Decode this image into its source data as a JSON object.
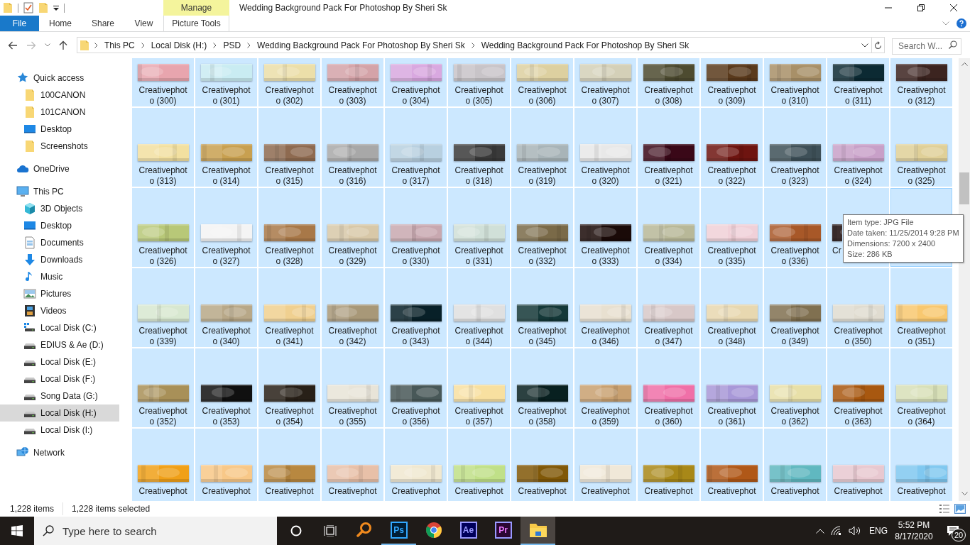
{
  "title_bar": {
    "title": "Wedding Background Pack For Photoshop By Sheri Sk",
    "contextual_group": "Manage"
  },
  "ribbon": {
    "tabs": [
      {
        "label": "File",
        "kind": "file",
        "selected": false
      },
      {
        "label": "Home",
        "kind": "tab",
        "selected": false
      },
      {
        "label": "Share",
        "kind": "tab",
        "selected": false
      },
      {
        "label": "View",
        "kind": "tab",
        "selected": false
      },
      {
        "label": "Picture Tools",
        "kind": "contextual",
        "selected": false
      }
    ]
  },
  "address_bar": {
    "breadcrumbs": [
      "This PC",
      "Local Disk (H:)",
      "PSD",
      "Wedding Background Pack For Photoshop By Sheri Sk",
      "Wedding Background Pack For Photoshop By Sheri Sk"
    ],
    "search_placeholder": "Search W..."
  },
  "navigation": [
    {
      "label": "Quick access",
      "kind": "star",
      "selected": false,
      "children": [
        {
          "label": "100CANON",
          "kind": "folder",
          "selected": false
        },
        {
          "label": "101CANON",
          "kind": "folder",
          "selected": false
        },
        {
          "label": "Desktop",
          "kind": "desktop",
          "selected": false
        },
        {
          "label": "Screenshots",
          "kind": "folder",
          "selected": false
        }
      ]
    },
    {
      "label": "OneDrive",
      "kind": "cloud",
      "selected": false
    },
    {
      "label": "This PC",
      "kind": "computer",
      "selected": false,
      "children": [
        {
          "label": "3D Objects",
          "kind": "cube",
          "selected": false
        },
        {
          "label": "Desktop",
          "kind": "desktop",
          "selected": false
        },
        {
          "label": "Documents",
          "kind": "document",
          "selected": false
        },
        {
          "label": "Downloads",
          "kind": "download",
          "selected": false
        },
        {
          "label": "Music",
          "kind": "music",
          "selected": false
        },
        {
          "label": "Pictures",
          "kind": "pictures",
          "selected": false
        },
        {
          "label": "Videos",
          "kind": "videos",
          "selected": false
        },
        {
          "label": "Local Disk (C:)",
          "kind": "system-disk",
          "selected": false
        },
        {
          "label": "EDIUS & Ae (D:)",
          "kind": "disk",
          "selected": false
        },
        {
          "label": "Local Disk (E:)",
          "kind": "disk",
          "selected": false
        },
        {
          "label": "Local Disk (F:)",
          "kind": "disk",
          "selected": false
        },
        {
          "label": "Song Data (G:)",
          "kind": "disk",
          "selected": false
        },
        {
          "label": "Local Disk (H:)",
          "kind": "disk",
          "selected": true
        },
        {
          "label": "Local Disk (I:)",
          "kind": "disk",
          "selected": false
        }
      ]
    },
    {
      "label": "Network",
      "kind": "network",
      "selected": false
    }
  ],
  "files": [
    {
      "label": "Creativephoto (300)",
      "kind": "file",
      "selected": true,
      "hovered": false
    },
    {
      "label": "Creativephoto (301)",
      "kind": "file",
      "selected": true,
      "hovered": false
    },
    {
      "label": "Creativephoto (302)",
      "kind": "file",
      "selected": true,
      "hovered": false
    },
    {
      "label": "Creativephoto (303)",
      "kind": "file",
      "selected": true,
      "hovered": false
    },
    {
      "label": "Creativephoto (304)",
      "kind": "file",
      "selected": true,
      "hovered": false
    },
    {
      "label": "Creativephoto (305)",
      "kind": "file",
      "selected": true,
      "hovered": false
    },
    {
      "label": "Creativephoto (306)",
      "kind": "file",
      "selected": true,
      "hovered": false
    },
    {
      "label": "Creativephoto (307)",
      "kind": "file",
      "selected": true,
      "hovered": false
    },
    {
      "label": "Creativephoto (308)",
      "kind": "file",
      "selected": true,
      "hovered": false
    },
    {
      "label": "Creativephoto (309)",
      "kind": "file",
      "selected": true,
      "hovered": false
    },
    {
      "label": "Creativephoto (310)",
      "kind": "file",
      "selected": true,
      "hovered": false
    },
    {
      "label": "Creativephoto (311)",
      "kind": "file",
      "selected": true,
      "hovered": false
    },
    {
      "label": "Creativephoto (312)",
      "kind": "file",
      "selected": true,
      "hovered": false
    },
    {
      "label": "Creativephoto (313)",
      "kind": "file",
      "selected": true,
      "hovered": false
    },
    {
      "label": "Creativephoto (314)",
      "kind": "file",
      "selected": true,
      "hovered": false
    },
    {
      "label": "Creativephoto (315)",
      "kind": "file",
      "selected": true,
      "hovered": false
    },
    {
      "label": "Creativephoto (316)",
      "kind": "file",
      "selected": true,
      "hovered": false
    },
    {
      "label": "Creativephoto (317)",
      "kind": "file",
      "selected": true,
      "hovered": false
    },
    {
      "label": "Creativephoto (318)",
      "kind": "file",
      "selected": true,
      "hovered": false
    },
    {
      "label": "Creativephoto (319)",
      "kind": "file",
      "selected": true,
      "hovered": false
    },
    {
      "label": "Creativephoto (320)",
      "kind": "file",
      "selected": true,
      "hovered": false
    },
    {
      "label": "Creativephoto (321)",
      "kind": "file",
      "selected": true,
      "hovered": false
    },
    {
      "label": "Creativephoto (322)",
      "kind": "file",
      "selected": true,
      "hovered": false
    },
    {
      "label": "Creativephoto (323)",
      "kind": "file",
      "selected": true,
      "hovered": false
    },
    {
      "label": "Creativephoto (324)",
      "kind": "file",
      "selected": true,
      "hovered": false
    },
    {
      "label": "Creativephoto (325)",
      "kind": "file",
      "selected": true,
      "hovered": false
    },
    {
      "label": "Creativephoto (326)",
      "kind": "file",
      "selected": true,
      "hovered": false
    },
    {
      "label": "Creativephoto (327)",
      "kind": "file",
      "selected": true,
      "hovered": false
    },
    {
      "label": "Creativephoto (328)",
      "kind": "file",
      "selected": true,
      "hovered": false
    },
    {
      "label": "Creativephoto (329)",
      "kind": "file",
      "selected": true,
      "hovered": false
    },
    {
      "label": "Creativephoto (330)",
      "kind": "file",
      "selected": true,
      "hovered": false
    },
    {
      "label": "Creativephoto (331)",
      "kind": "file",
      "selected": true,
      "hovered": false
    },
    {
      "label": "Creativephoto (332)",
      "kind": "file",
      "selected": true,
      "hovered": false
    },
    {
      "label": "Creativephoto (333)",
      "kind": "file",
      "selected": true,
      "hovered": false
    },
    {
      "label": "Creativephoto (334)",
      "kind": "file",
      "selected": true,
      "hovered": false
    },
    {
      "label": "Creativephoto (335)",
      "kind": "file",
      "selected": true,
      "hovered": false
    },
    {
      "label": "Creativephoto (336)",
      "kind": "file",
      "selected": true,
      "hovered": false
    },
    {
      "label": "Cr",
      "kind": "partial",
      "selected": true,
      "hovered": false
    },
    {
      "kind": "covered",
      "selected": true,
      "hovered": true
    },
    {
      "label": "Creativephoto (339)",
      "kind": "file",
      "selected": true,
      "hovered": false
    },
    {
      "label": "Creativephoto (340)",
      "kind": "file",
      "selected": true,
      "hovered": false
    },
    {
      "label": "Creativephoto (341)",
      "kind": "file",
      "selected": true,
      "hovered": false
    },
    {
      "label": "Creativephoto (342)",
      "kind": "file",
      "selected": true,
      "hovered": false
    },
    {
      "label": "Creativephoto (343)",
      "kind": "file",
      "selected": true,
      "hovered": false
    },
    {
      "label": "Creativephoto (344)",
      "kind": "file",
      "selected": true,
      "hovered": false
    },
    {
      "label": "Creativephoto (345)",
      "kind": "file",
      "selected": true,
      "hovered": false
    },
    {
      "label": "Creativephoto (346)",
      "kind": "file",
      "selected": true,
      "hovered": false
    },
    {
      "label": "Creativephoto (347)",
      "kind": "file",
      "selected": true,
      "hovered": false
    },
    {
      "label": "Creativephoto (348)",
      "kind": "file",
      "selected": true,
      "hovered": false
    },
    {
      "label": "Creativephoto (349)",
      "kind": "file",
      "selected": true,
      "hovered": false
    },
    {
      "label": "Creativephoto (350)",
      "kind": "file",
      "selected": true,
      "hovered": false
    },
    {
      "label": "Creativephoto (351)",
      "kind": "file",
      "selected": true,
      "hovered": false
    },
    {
      "label": "Creativephoto (352)",
      "kind": "file",
      "selected": true,
      "hovered": false
    },
    {
      "label": "Creativephoto (353)",
      "kind": "file",
      "selected": true,
      "hovered": false
    },
    {
      "label": "Creativephoto (354)",
      "kind": "file",
      "selected": true,
      "hovered": false
    },
    {
      "label": "Creativephoto (355)",
      "kind": "file",
      "selected": true,
      "hovered": false
    },
    {
      "label": "Creativephoto (356)",
      "kind": "file",
      "selected": true,
      "hovered": false
    },
    {
      "label": "Creativephoto (357)",
      "kind": "file",
      "selected": true,
      "hovered": false
    },
    {
      "label": "Creativephoto (358)",
      "kind": "file",
      "selected": true,
      "hovered": false
    },
    {
      "label": "Creativephoto (359)",
      "kind": "file",
      "selected": true,
      "hovered": false
    },
    {
      "label": "Creativephoto (360)",
      "kind": "file",
      "selected": true,
      "hovered": false
    },
    {
      "label": "Creativephoto (361)",
      "kind": "file",
      "selected": true,
      "hovered": false
    },
    {
      "label": "Creativephoto (362)",
      "kind": "file",
      "selected": true,
      "hovered": false
    },
    {
      "label": "Creativephoto (363)",
      "kind": "file",
      "selected": true,
      "hovered": false
    },
    {
      "label": "Creativephoto (364)",
      "kind": "file",
      "selected": true,
      "hovered": false
    },
    {
      "label": "Creativephot",
      "kind": "file",
      "selected": true,
      "hovered": false
    },
    {
      "label": "Creativephot",
      "kind": "file",
      "selected": true,
      "hovered": false
    },
    {
      "label": "Creativephot",
      "kind": "file",
      "selected": true,
      "hovered": false
    },
    {
      "label": "Creativephot",
      "kind": "file",
      "selected": true,
      "hovered": false
    },
    {
      "label": "Creativephot",
      "kind": "file",
      "selected": true,
      "hovered": false
    },
    {
      "label": "Creativephot",
      "kind": "file",
      "selected": true,
      "hovered": false
    },
    {
      "label": "Creativephot",
      "kind": "file",
      "selected": true,
      "hovered": false
    },
    {
      "label": "Creativephot",
      "kind": "file",
      "selected": true,
      "hovered": false
    },
    {
      "label": "Creativephot",
      "kind": "file",
      "selected": true,
      "hovered": false
    },
    {
      "label": "Creativephot",
      "kind": "file",
      "selected": true,
      "hovered": false
    },
    {
      "label": "Creativephot",
      "kind": "file",
      "selected": true,
      "hovered": false
    },
    {
      "label": "Creativephot",
      "kind": "file",
      "selected": true,
      "hovered": false
    },
    {
      "label": "Creativephot",
      "kind": "file",
      "selected": true,
      "hovered": false
    }
  ],
  "tooltip": {
    "lines": [
      "Item type: JPG File",
      "Date taken: 11/25/2014 9:28 PM",
      "Dimensions: 7200 x 2400",
      "Size: 286 KB"
    ]
  },
  "status_bar": {
    "item_count": "1,228 items",
    "selection": "1,228 items selected"
  },
  "taskbar": {
    "search_placeholder": "Type here to search",
    "apps": [
      {
        "kind": "magnifier",
        "running": false,
        "selected": false
      },
      {
        "kind": "ps",
        "label": "Ps",
        "running": true,
        "selected": false
      },
      {
        "kind": "chrome",
        "running": false,
        "selected": false
      },
      {
        "kind": "ae",
        "label": "Ae",
        "running": false,
        "selected": false
      },
      {
        "kind": "pr",
        "label": "Pr",
        "running": false,
        "selected": false
      },
      {
        "kind": "explorer",
        "running": true,
        "selected": true
      }
    ],
    "tray": {
      "language": "ENG",
      "time": "5:52 PM",
      "date": "8/17/2020",
      "notifications": "20"
    }
  }
}
